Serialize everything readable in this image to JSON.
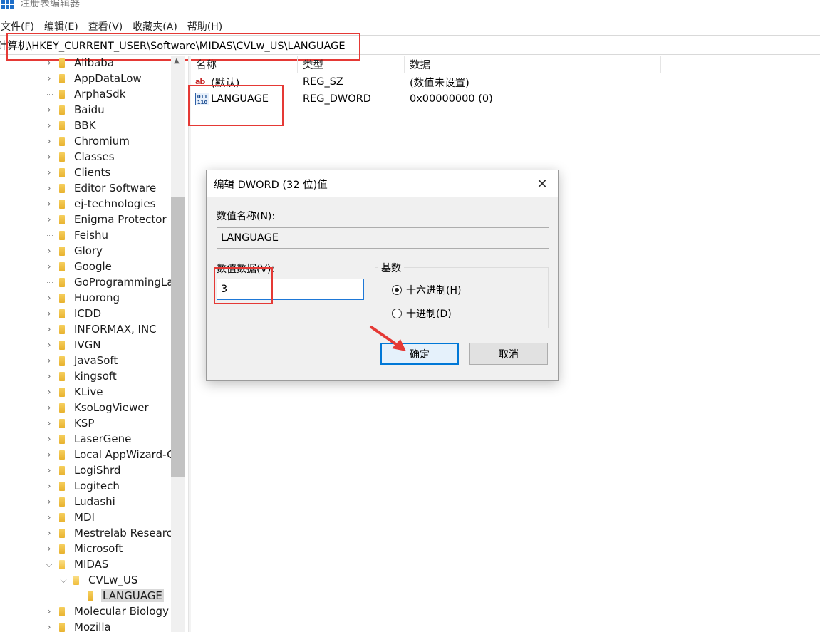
{
  "window": {
    "title": "注册表编辑器",
    "accent": "#0078d7",
    "highlight": "#e53935"
  },
  "menu": [
    "文件(F)",
    "编辑(E)",
    "查看(V)",
    "收藏夹(A)",
    "帮助(H)"
  ],
  "address": "计算机\\HKEY_CURRENT_USER\\Software\\MIDAS\\CVLw_US\\LANGUAGE",
  "tree": [
    {
      "label": "Alibaba",
      "chev": "›"
    },
    {
      "label": "AppDataLow",
      "chev": "›"
    },
    {
      "label": "ArphaSdk",
      "chev": ""
    },
    {
      "label": "Baidu",
      "chev": "›"
    },
    {
      "label": "BBK",
      "chev": "›"
    },
    {
      "label": "Chromium",
      "chev": "›"
    },
    {
      "label": "Classes",
      "chev": "›"
    },
    {
      "label": "Clients",
      "chev": "›"
    },
    {
      "label": "Editor Software",
      "chev": "›"
    },
    {
      "label": "ej-technologies",
      "chev": "›"
    },
    {
      "label": "Enigma Protector",
      "chev": "›"
    },
    {
      "label": "Feishu",
      "chev": ""
    },
    {
      "label": "Glory",
      "chev": "›"
    },
    {
      "label": "Google",
      "chev": "›"
    },
    {
      "label": "GoProgrammingLa",
      "chev": ""
    },
    {
      "label": "Huorong",
      "chev": "›"
    },
    {
      "label": "ICDD",
      "chev": "›"
    },
    {
      "label": "INFORMAX, INC",
      "chev": "›"
    },
    {
      "label": "IVGN",
      "chev": "›"
    },
    {
      "label": "JavaSoft",
      "chev": "›"
    },
    {
      "label": "kingsoft",
      "chev": "›"
    },
    {
      "label": "KLive",
      "chev": "›"
    },
    {
      "label": "KsoLogViewer",
      "chev": "›"
    },
    {
      "label": "KSP",
      "chev": "›"
    },
    {
      "label": "LaserGene",
      "chev": "›"
    },
    {
      "label": "Local AppWizard-G",
      "chev": "›"
    },
    {
      "label": "LogiShrd",
      "chev": "›"
    },
    {
      "label": "Logitech",
      "chev": "›"
    },
    {
      "label": "Ludashi",
      "chev": "›"
    },
    {
      "label": "MDI",
      "chev": "›"
    },
    {
      "label": "Mestrelab Researc",
      "chev": "›"
    },
    {
      "label": "Microsoft",
      "chev": "›"
    },
    {
      "label": "MIDAS",
      "chev": "⌄"
    },
    {
      "label": "CVLw_US",
      "chev": "⌄"
    },
    {
      "label": "LANGUAGE",
      "chev": ""
    },
    {
      "label": "Molecular Biology",
      "chev": "›"
    },
    {
      "label": "Mozilla",
      "chev": "›"
    }
  ],
  "list": {
    "headers": [
      "名称",
      "类型",
      "数据"
    ],
    "rows": [
      {
        "icon": "ab",
        "name": "(默认)",
        "type": "REG_SZ",
        "data": "(数值未设置)"
      },
      {
        "icon": "binary",
        "name": "LANGUAGE",
        "type": "REG_DWORD",
        "data": "0x00000000 (0)"
      }
    ]
  },
  "dialog": {
    "title": "编辑 DWORD (32 位)值",
    "name_label": "数值名称(N):",
    "name_value": "LANGUAGE",
    "data_label": "数值数据(V):",
    "data_value": "3",
    "base_label": "基数",
    "radio_hex": "十六进制(H)",
    "radio_dec": "十进制(D)",
    "selected_base": "hex",
    "ok": "确定",
    "cancel": "取消"
  }
}
